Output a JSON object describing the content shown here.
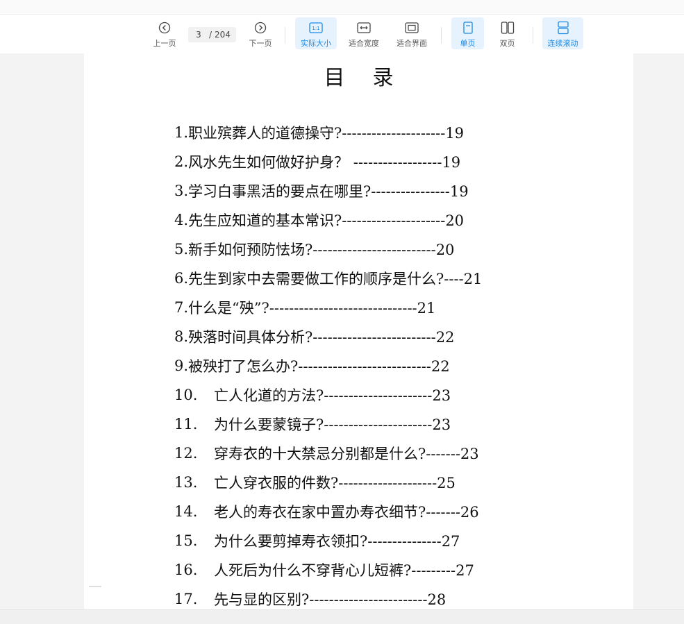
{
  "toolbar": {
    "prev_label": "上一页",
    "next_label": "下一页",
    "current_page": "3",
    "page_sep": "/",
    "total_pages": "204",
    "actual_size_label": "实际大小",
    "actual_size_icon_text": "1:1",
    "fit_width_label": "适合宽度",
    "fit_page_label": "适合界面",
    "single_page_label": "单页",
    "double_page_label": "双页",
    "continuous_label": "连续滚动",
    "accent_color": "#1a8ae5"
  },
  "document": {
    "title": "目录",
    "toc": [
      {
        "num": "1.",
        "text": "职业殡葬人的道德操守?---------------------19"
      },
      {
        "num": "2.",
        "text": "风水先生如何做好护身？ ------------------19"
      },
      {
        "num": "3.",
        "text": "学习白事黑活的要点在哪里?----------------19"
      },
      {
        "num": "4.",
        "text": "先生应知道的基本常识?---------------------20"
      },
      {
        "num": "5.",
        "text": "新手如何预防怯场?-------------------------20"
      },
      {
        "num": "6.",
        "text": "先生到家中去需要做工作的顺序是什么?----21"
      },
      {
        "num": "7.",
        "text": "什么是“殃”?------------------------------21"
      },
      {
        "num": "8.",
        "text": "殃落时间具体分析?-------------------------22"
      },
      {
        "num": "9.",
        "text": "被殃打了怎么办?---------------------------22"
      },
      {
        "num": "10.",
        "text": "亡人化道的方法?----------------------23"
      },
      {
        "num": "11.",
        "text": "为什么要蒙镜子?----------------------23"
      },
      {
        "num": "12.",
        "text": "穿寿衣的十大禁忌分别都是什么?-------23"
      },
      {
        "num": "13.",
        "text": "亡人穿衣服的件数?--------------------25"
      },
      {
        "num": "14.",
        "text": "老人的寿衣在家中置办寿衣细节?-------26"
      },
      {
        "num": "15.",
        "text": "为什么要剪掉寿衣领扣?---------------27"
      },
      {
        "num": "16.",
        "text": "人死后为什么不穿背心儿短裤?---------27"
      },
      {
        "num": "17.",
        "text": "先与显的区别?------------------------28"
      }
    ]
  }
}
